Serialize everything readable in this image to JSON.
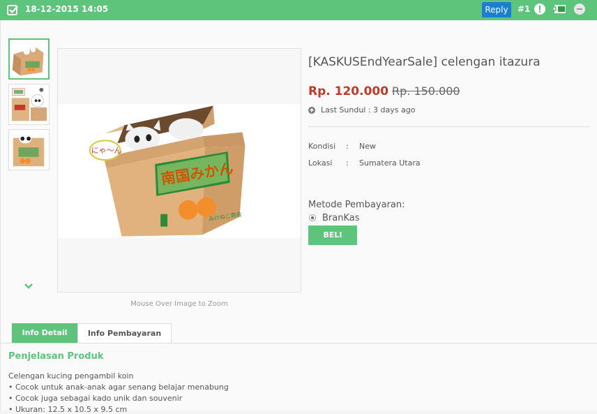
{
  "header": {
    "timestamp": "18-12-2015 14:05",
    "reply_label": "Reply",
    "post_number": "#1",
    "icons": [
      "check-icon",
      "warning-icon",
      "sale-icon",
      "more-icon"
    ],
    "background_color": "#5ec47b",
    "reply_color": "#1a7fd2"
  },
  "gallery": {
    "zoom_hint": "Mouse Over Image to Zoom",
    "thumbnails": [
      "thumbnail-1",
      "thumbnail-2",
      "thumbnail-3"
    ],
    "active_thumbnail": 0
  },
  "product": {
    "title": "[KASKUSEndYearSale] celengan itazura",
    "price": "Rp. 120.000",
    "old_price": "Rp. 150.000",
    "last_sundul": "Last Sundul : 3 days ago",
    "specs": [
      {
        "label": "Kondisi",
        "colon": ":",
        "value": "New"
      },
      {
        "label": "Lokasi",
        "colon": ":",
        "value": "Sumatera Utara"
      }
    ],
    "payment_title": "Metode Pembayaran:",
    "payment_option": "BranKas",
    "buy_label": "BELI",
    "price_color": "#c0392b",
    "accent_color": "#5ec47b"
  },
  "tabs": [
    {
      "label": "Info Detail",
      "active": true
    },
    {
      "label": "Info Pembayaran",
      "active": false
    }
  ],
  "description": {
    "title": "Penjelasan Produk",
    "lines": [
      "Celengan kucing pengambil koin",
      "• Cocok untuk anak-anak agar senang belajar menabung",
      "• Cocok juga sebagai kado unik dan souvenir",
      "• Ukuran: 12.5 x 10.5 x 9.5 cm"
    ]
  },
  "image_text": {
    "box_label": "南国みかん",
    "speech": "にゃ〜ん",
    "small_label": "みけねこ商会"
  }
}
